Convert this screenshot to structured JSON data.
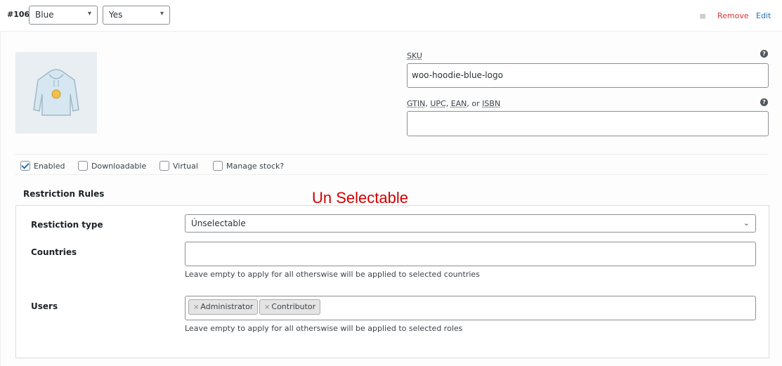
{
  "header": {
    "variation_id": "#106",
    "attribute_color": "Blue",
    "attribute_logo": "Yes",
    "drag_icon": "menu-icon",
    "remove_label": "Remove",
    "edit_label": "Edit"
  },
  "colors": {
    "link": "#2271b1",
    "danger": "#d63638",
    "annotation": "#d10000"
  },
  "fields": {
    "sku_label": "SKU",
    "sku_value": "woo-hoodie-blue-logo",
    "gtin_label_1": "GTIN",
    "gtin_label_2": "UPC",
    "gtin_label_3": "EAN",
    "gtin_label_4": "or",
    "gtin_label_5": "ISBN",
    "gtin_value": ""
  },
  "options": [
    {
      "label": "Enabled",
      "checked": true
    },
    {
      "label": "Downloadable",
      "checked": false
    },
    {
      "label": "Virtual",
      "checked": false
    },
    {
      "label": "Manage stock?",
      "checked": false
    }
  ],
  "restrictions": {
    "title": "Restriction Rules",
    "annotation": "Un Selectable",
    "type_label": "Restiction type",
    "type_value": "Únselectable",
    "countries_label": "Countries",
    "countries_help": "Leave empty to apply for all otherswise will be applied to selected countries",
    "users_label": "Users",
    "users_tokens": [
      "Administrator",
      "Contributor"
    ],
    "users_help": "Leave empty to apply for all otherswise will be applied to selected roles"
  }
}
